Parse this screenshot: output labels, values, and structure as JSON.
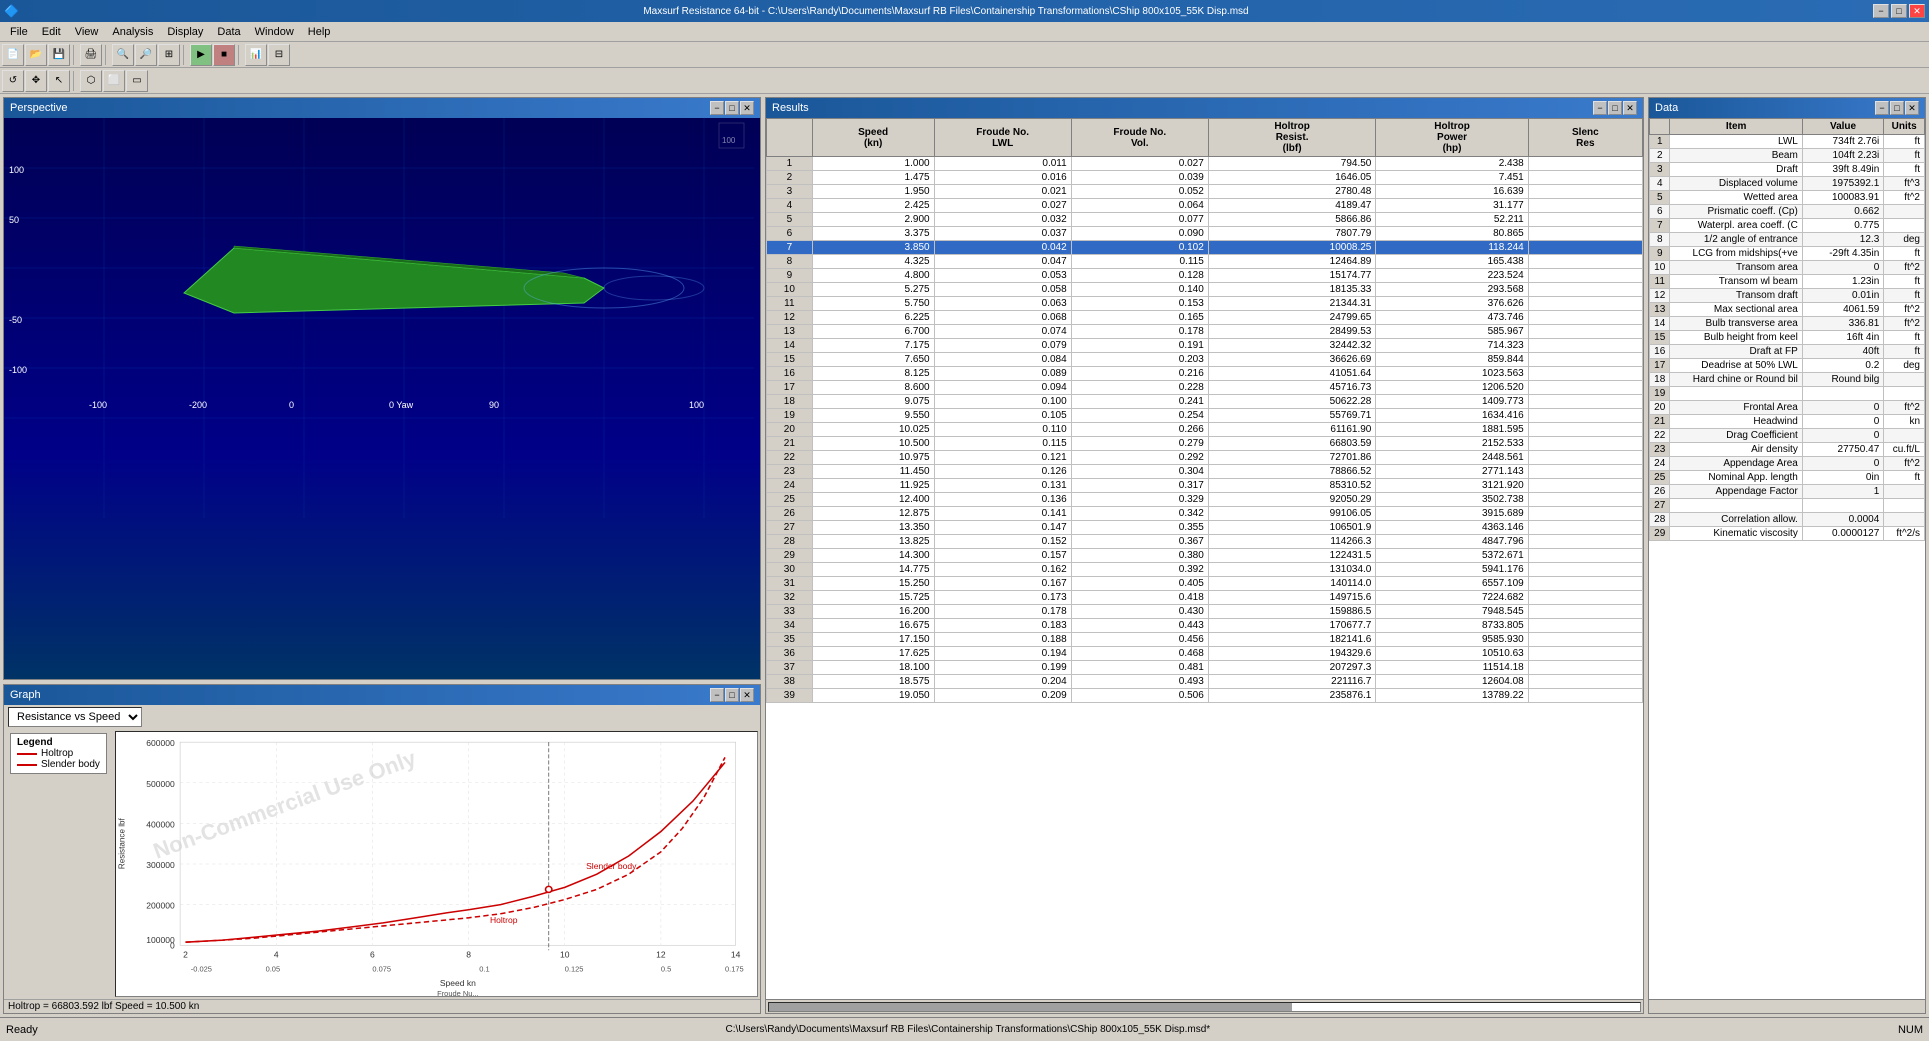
{
  "titleBar": {
    "title": "Maxsurf Resistance 64-bit - C:\\Users\\Randy\\Documents\\Maxsurf RB Files\\Containership Transformations\\CShip 800x105_55K Disp.msd",
    "minimize": "−",
    "maximize": "□",
    "close": "✕"
  },
  "menu": {
    "items": [
      "File",
      "Edit",
      "View",
      "Analysis",
      "Display",
      "Data",
      "Window",
      "Help"
    ]
  },
  "panels": {
    "perspective": "Perspective",
    "graph": "Graph",
    "results": "Results",
    "data": "Data"
  },
  "graph": {
    "dropdown_value": "Resistance vs Speed",
    "legend_title": "Legend",
    "legend_items": [
      {
        "name": "Holtrop",
        "color": "#cc0000"
      },
      {
        "name": "Slender body",
        "color": "#cc0000"
      }
    ],
    "x_label": "Speed  kn",
    "y_label": "Resistance  lbf",
    "x_axis2": "Froude Nu...",
    "holtrop_label": "Holtrop = 66803.592 lbf   Speed = 10.500 kn",
    "resistance_speed_label": "Resistance Speed"
  },
  "results": {
    "columns": [
      "",
      "Speed\n(kn)",
      "Froude No.\nLWL",
      "Froude No.\nVol.",
      "Holtrop\nResist.\n(lbf)",
      "Holtrop\nPower\n(hp)",
      "Slenc\nRes"
    ],
    "selectedRow": 7,
    "rows": [
      [
        1,
        "1.000",
        "0.011",
        "0.027",
        "794.50",
        "2.438",
        ""
      ],
      [
        2,
        "1.475",
        "0.016",
        "0.039",
        "1646.05",
        "7.451",
        ""
      ],
      [
        3,
        "1.950",
        "0.021",
        "0.052",
        "2780.48",
        "16.639",
        ""
      ],
      [
        4,
        "2.425",
        "0.027",
        "0.064",
        "4189.47",
        "31.177",
        ""
      ],
      [
        5,
        "2.900",
        "0.032",
        "0.077",
        "5866.86",
        "52.211",
        ""
      ],
      [
        6,
        "3.375",
        "0.037",
        "0.090",
        "7807.79",
        "80.865",
        ""
      ],
      [
        7,
        "3.850",
        "0.042",
        "0.102",
        "10008.25",
        "118.244",
        ""
      ],
      [
        8,
        "4.325",
        "0.047",
        "0.115",
        "12464.89",
        "165.438",
        ""
      ],
      [
        9,
        "4.800",
        "0.053",
        "0.128",
        "15174.77",
        "223.524",
        ""
      ],
      [
        10,
        "5.275",
        "0.058",
        "0.140",
        "18135.33",
        "293.568",
        ""
      ],
      [
        11,
        "5.750",
        "0.063",
        "0.153",
        "21344.31",
        "376.626",
        ""
      ],
      [
        12,
        "6.225",
        "0.068",
        "0.165",
        "24799.65",
        "473.746",
        ""
      ],
      [
        13,
        "6.700",
        "0.074",
        "0.178",
        "28499.53",
        "585.967",
        ""
      ],
      [
        14,
        "7.175",
        "0.079",
        "0.191",
        "32442.32",
        "714.323",
        ""
      ],
      [
        15,
        "7.650",
        "0.084",
        "0.203",
        "36626.69",
        "859.844",
        ""
      ],
      [
        16,
        "8.125",
        "0.089",
        "0.216",
        "41051.64",
        "1023.563",
        ""
      ],
      [
        17,
        "8.600",
        "0.094",
        "0.228",
        "45716.73",
        "1206.520",
        ""
      ],
      [
        18,
        "9.075",
        "0.100",
        "0.241",
        "50622.28",
        "1409.773",
        ""
      ],
      [
        19,
        "9.550",
        "0.105",
        "0.254",
        "55769.71",
        "1634.416",
        ""
      ],
      [
        20,
        "10.025",
        "0.110",
        "0.266",
        "61161.90",
        "1881.595",
        ""
      ],
      [
        21,
        "10.500",
        "0.115",
        "0.279",
        "66803.59",
        "2152.533",
        ""
      ],
      [
        22,
        "10.975",
        "0.121",
        "0.292",
        "72701.86",
        "2448.561",
        ""
      ],
      [
        23,
        "11.450",
        "0.126",
        "0.304",
        "78866.52",
        "2771.143",
        ""
      ],
      [
        24,
        "11.925",
        "0.131",
        "0.317",
        "85310.52",
        "3121.920",
        ""
      ],
      [
        25,
        "12.400",
        "0.136",
        "0.329",
        "92050.29",
        "3502.738",
        ""
      ],
      [
        26,
        "12.875",
        "0.141",
        "0.342",
        "99106.05",
        "3915.689",
        ""
      ],
      [
        27,
        "13.350",
        "0.147",
        "0.355",
        "106501.9",
        "4363.146",
        ""
      ],
      [
        28,
        "13.825",
        "0.152",
        "0.367",
        "114266.3",
        "4847.796",
        ""
      ],
      [
        29,
        "14.300",
        "0.157",
        "0.380",
        "122431.5",
        "5372.671",
        ""
      ],
      [
        30,
        "14.775",
        "0.162",
        "0.392",
        "131034.0",
        "5941.176",
        ""
      ],
      [
        31,
        "15.250",
        "0.167",
        "0.405",
        "140114.0",
        "6557.109",
        ""
      ],
      [
        32,
        "15.725",
        "0.173",
        "0.418",
        "149715.6",
        "7224.682",
        ""
      ],
      [
        33,
        "16.200",
        "0.178",
        "0.430",
        "159886.5",
        "7948.545",
        ""
      ],
      [
        34,
        "16.675",
        "0.183",
        "0.443",
        "170677.7",
        "8733.805",
        ""
      ],
      [
        35,
        "17.150",
        "0.188",
        "0.456",
        "182141.6",
        "9585.930",
        ""
      ],
      [
        36,
        "17.625",
        "0.194",
        "0.468",
        "194329.6",
        "10510.63",
        ""
      ],
      [
        37,
        "18.100",
        "0.199",
        "0.481",
        "207297.3",
        "11514.18",
        ""
      ],
      [
        38,
        "18.575",
        "0.204",
        "0.493",
        "221116.7",
        "12604.08",
        ""
      ],
      [
        39,
        "19.050",
        "0.209",
        "0.506",
        "235876.1",
        "13789.22",
        ""
      ]
    ]
  },
  "dataPanel": {
    "columns": [
      "",
      "Item",
      "Value",
      "Units"
    ],
    "rows": [
      [
        1,
        "LWL",
        "734ft 2.76i",
        "ft"
      ],
      [
        2,
        "Beam",
        "104ft 2.23i",
        "ft"
      ],
      [
        3,
        "Draft",
        "39ft 8.49in",
        "ft"
      ],
      [
        4,
        "Displaced volume",
        "1975392.1",
        "ft^3"
      ],
      [
        5,
        "Wetted area",
        "100083.91",
        "ft^2"
      ],
      [
        6,
        "Prismatic coeff. (Cp)",
        "0.662",
        ""
      ],
      [
        7,
        "Waterpl. area coeff. (C",
        "0.775",
        ""
      ],
      [
        8,
        "1/2 angle of entrance",
        "12.3",
        "deg"
      ],
      [
        9,
        "LCG from midships(+ve",
        "-29ft 4.35in",
        "ft"
      ],
      [
        10,
        "Transom area",
        "0",
        "ft^2"
      ],
      [
        11,
        "Transom wl beam",
        "1.23in",
        "ft"
      ],
      [
        12,
        "Transom draft",
        "0.01in",
        "ft"
      ],
      [
        13,
        "Max sectional area",
        "4061.59",
        "ft^2"
      ],
      [
        14,
        "Bulb transverse area",
        "336.81",
        "ft^2"
      ],
      [
        15,
        "Bulb height from keel",
        "16ft 4in",
        "ft"
      ],
      [
        16,
        "Draft at FP",
        "40ft",
        "ft"
      ],
      [
        17,
        "Deadrise at 50% LWL",
        "0.2",
        "deg"
      ],
      [
        18,
        "Hard chine or Round bil",
        "Round bilg",
        ""
      ],
      [
        19,
        "",
        "",
        ""
      ],
      [
        20,
        "Frontal Area",
        "0",
        "ft^2"
      ],
      [
        21,
        "Headwind",
        "0",
        "kn"
      ],
      [
        22,
        "Drag Coefficient",
        "0",
        ""
      ],
      [
        23,
        "Air density",
        "27750.47",
        "cu.ft/L"
      ],
      [
        24,
        "Appendage Area",
        "0",
        "ft^2"
      ],
      [
        25,
        "Nominal App. length",
        "0in",
        "ft"
      ],
      [
        26,
        "Appendage Factor",
        "1",
        ""
      ],
      [
        27,
        "",
        "",
        ""
      ],
      [
        28,
        "Correlation allow.",
        "0.0004",
        ""
      ],
      [
        29,
        "Kinematic viscosity",
        "0.0000127",
        "ft^2/s"
      ]
    ]
  },
  "statusBar": {
    "ready": "Ready",
    "filepath": "C:\\Users\\Randy\\Documents\\Maxsurf RB Files\\Containership Transformations\\CShip 800x105_55K Disp.msd*",
    "num": "NUM"
  },
  "watermark": "Non-Commercial Use Only"
}
